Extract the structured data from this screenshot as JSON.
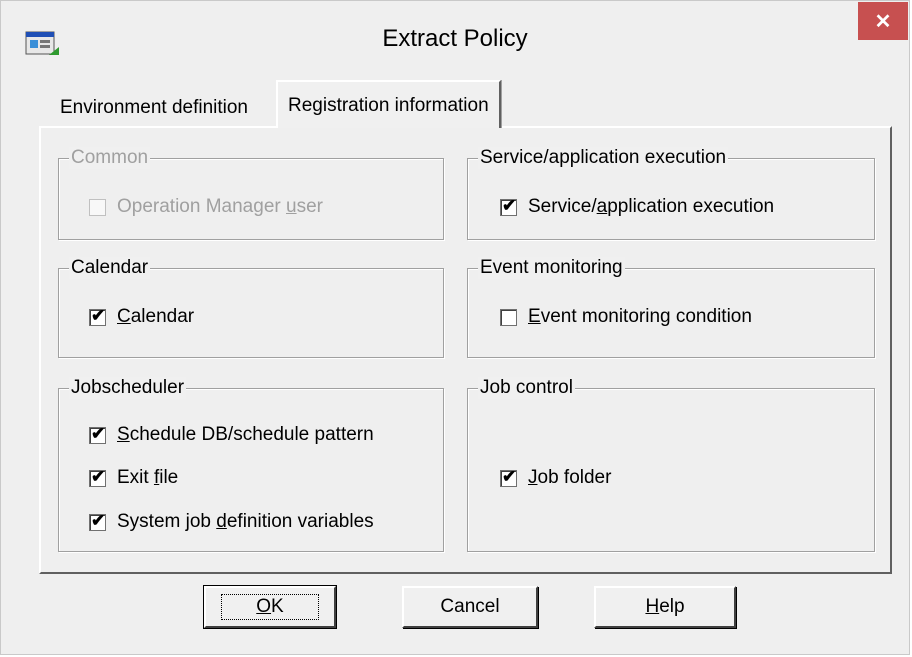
{
  "window": {
    "title": "Extract Policy",
    "icon": "app-window-icon",
    "close_icon": "close-icon"
  },
  "tabs": [
    {
      "label": "Environment definition",
      "active": false
    },
    {
      "label": "Registration information",
      "active": true
    }
  ],
  "groups": {
    "common": {
      "legend": "Common",
      "enabled": false,
      "items": [
        {
          "pre": "Operation Manager ",
          "mnemonic": "u",
          "post": "ser",
          "checked": false
        }
      ]
    },
    "calendar": {
      "legend": "Calendar",
      "items": [
        {
          "pre": "",
          "mnemonic": "C",
          "post": "alendar",
          "checked": true
        }
      ]
    },
    "jobscheduler": {
      "legend": "Jobscheduler",
      "items": [
        {
          "pre": "",
          "mnemonic": "S",
          "post": "chedule DB/schedule pattern",
          "checked": true
        },
        {
          "pre": "Exit ",
          "mnemonic": "f",
          "post": "ile",
          "checked": true
        },
        {
          "pre": "System job ",
          "mnemonic": "d",
          "post": "efinition variables",
          "checked": true
        }
      ]
    },
    "service": {
      "legend": "Service/application execution",
      "items": [
        {
          "pre": "Service/",
          "mnemonic": "a",
          "post": "pplication execution",
          "checked": true
        }
      ]
    },
    "event": {
      "legend": "Event monitoring",
      "items": [
        {
          "pre": "",
          "mnemonic": "E",
          "post": "vent monitoring condition",
          "checked": false
        }
      ]
    },
    "jobcontrol": {
      "legend": "Job control",
      "items": [
        {
          "pre": "",
          "mnemonic": "J",
          "post": "ob folder",
          "checked": true
        }
      ]
    }
  },
  "buttons": {
    "ok": {
      "mnemonic": "O",
      "post": "K"
    },
    "cancel": {
      "label": "Cancel"
    },
    "help": {
      "mnemonic": "H",
      "post": "elp"
    }
  },
  "checkmark_glyph": "✔"
}
